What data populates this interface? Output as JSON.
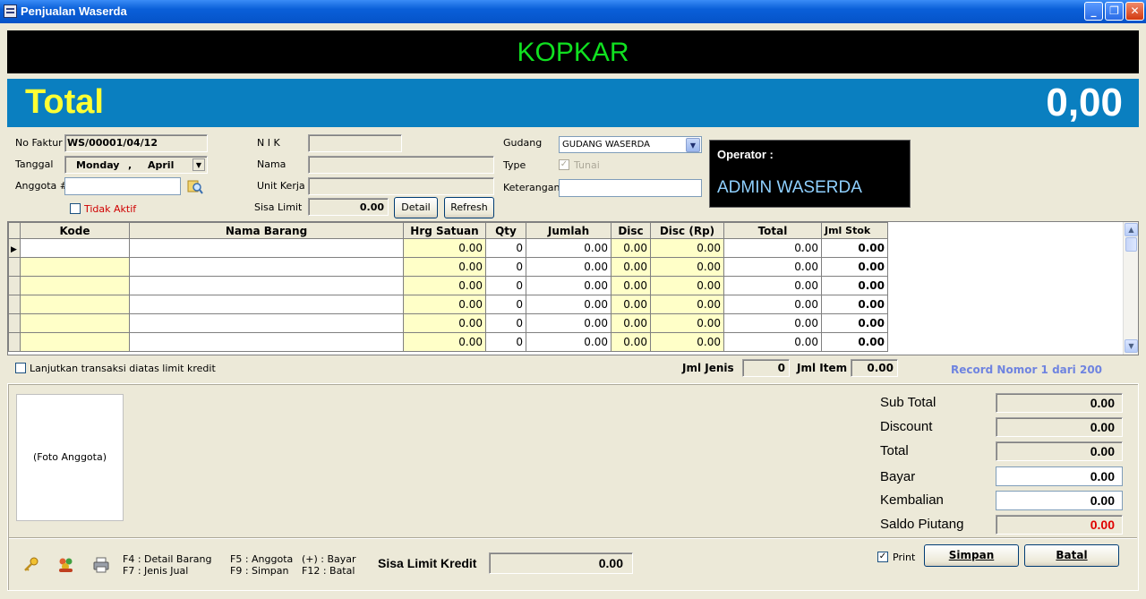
{
  "window": {
    "title": "Penjualan Waserda"
  },
  "banner": {
    "company": "KOPKAR"
  },
  "total": {
    "label": "Total",
    "value": "0,00"
  },
  "form": {
    "no_faktur_label": "No Faktur",
    "no_faktur": "WS/00001/04/12",
    "tanggal_label": "Tanggal",
    "tanggal_day": "Monday",
    "tanggal_sep": ",",
    "tanggal_month": "April",
    "anggota_label": "Anggota #",
    "anggota": "",
    "tidak_aktif_label": "Tidak Aktif",
    "nik_label": "N I K",
    "nama_label": "Nama",
    "unit_kerja_label": "Unit Kerja",
    "sisa_limit_label": "Sisa Limit",
    "sisa_limit": "0.00",
    "detail_button": "Detail",
    "refresh_button": "Refresh",
    "gudang_label": "Gudang",
    "gudang": "GUDANG WASERDA",
    "type_label": "Type",
    "tunai_label": "Tunai",
    "keterangan_label": "Keterangan"
  },
  "operator": {
    "label": "Operator :",
    "name": "ADMIN WASERDA"
  },
  "grid": {
    "columns": [
      "Kode",
      "Nama Barang",
      "Hrg Satuan",
      "Qty",
      "Jumlah",
      "Disc",
      "Disc (Rp)",
      "Total",
      "Jml Stok"
    ],
    "rows": [
      [
        "",
        "",
        "0.00",
        "0",
        "0.00",
        "0.00",
        "0.00",
        "0.00",
        "0.00"
      ],
      [
        "",
        "",
        "0.00",
        "0",
        "0.00",
        "0.00",
        "0.00",
        "0.00",
        "0.00"
      ],
      [
        "",
        "",
        "0.00",
        "0",
        "0.00",
        "0.00",
        "0.00",
        "0.00",
        "0.00"
      ],
      [
        "",
        "",
        "0.00",
        "0",
        "0.00",
        "0.00",
        "0.00",
        "0.00",
        "0.00"
      ],
      [
        "",
        "",
        "0.00",
        "0",
        "0.00",
        "0.00",
        "0.00",
        "0.00",
        "0.00"
      ],
      [
        "",
        "",
        "0.00",
        "0",
        "0.00",
        "0.00",
        "0.00",
        "0.00",
        "0.00"
      ]
    ]
  },
  "status": {
    "lanjutkan_label": "Lanjutkan transaksi diatas limit kredit",
    "jml_jenis_label": "Jml Jenis",
    "jml_jenis": "0",
    "jml_item_label": "Jml Item",
    "jml_item": "0.00",
    "record": "Record Nomor 1 dari 200"
  },
  "foto": {
    "placeholder": "(Foto Anggota)"
  },
  "summary": {
    "sub_total_label": "Sub Total",
    "sub_total": "0.00",
    "discount_label": "Discount",
    "discount": "0.00",
    "total_label": "Total",
    "total": "0.00",
    "bayar_label": "Bayar",
    "bayar": "0.00",
    "kembalian_label": "Kembalian",
    "kembalian": "0.00",
    "saldo_piutang_label": "Saldo Piutang",
    "saldo_piutang": "0.00"
  },
  "footer": {
    "hint_f4": "F4 : Detail Barang",
    "hint_f7": "F7 : Jenis Jual",
    "hint_f5": "F5 : Anggota",
    "hint_f9": "F9 : Simpan",
    "hint_plus": "(+) : Bayar",
    "hint_f12": "F12 : Batal",
    "sisa_limit_kredit_label": "Sisa Limit Kredit",
    "sisa_limit_kredit": "0.00",
    "print_label": "Print",
    "simpan_button": "Simpan",
    "batal_button": "Batal"
  },
  "colors": {
    "banner_bg": "#000000",
    "banner_text": "#10e020",
    "total_bg": "#0a7fc0",
    "total_label": "#ffff33",
    "record_text": "#6f84e0",
    "saldo_red": "#e00000"
  }
}
